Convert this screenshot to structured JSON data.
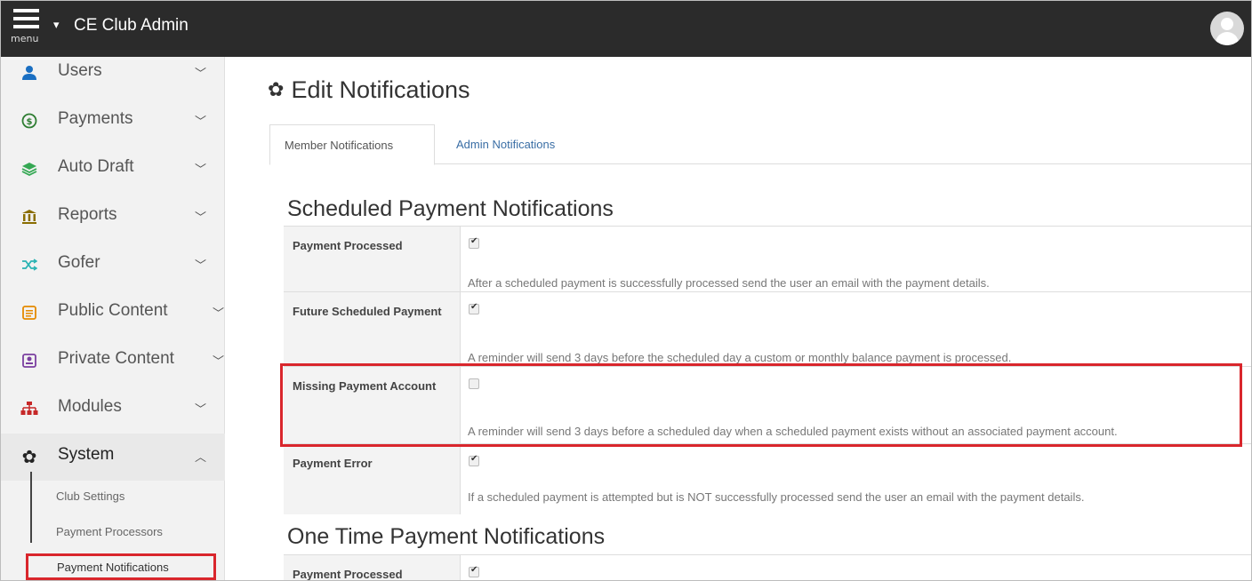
{
  "header": {
    "menu_label": "menu",
    "app_title": "CE Club Admin"
  },
  "sidebar": {
    "items": [
      {
        "label": "Users",
        "icon": "user-icon",
        "color": "#1a6fc2"
      },
      {
        "label": "Payments",
        "icon": "dollar-circle-icon",
        "color": "#2e7d32"
      },
      {
        "label": "Auto Draft",
        "icon": "layers-icon",
        "color": "#34a853"
      },
      {
        "label": "Reports",
        "icon": "bank-icon",
        "color": "#8a6d00"
      },
      {
        "label": "Gofer",
        "icon": "shuffle-icon",
        "color": "#2bb3b3"
      },
      {
        "label": "Public Content",
        "icon": "document-icon",
        "color": "#e58a00"
      },
      {
        "label": "Private Content",
        "icon": "private-document-icon",
        "color": "#7b3fa0"
      },
      {
        "label": "Modules",
        "icon": "sitemap-icon",
        "color": "#c62828"
      },
      {
        "label": "System",
        "icon": "gear-icon",
        "color": "#222222"
      }
    ],
    "system_subitems": [
      "Club Settings",
      "Payment Processors",
      "Payment Notifications"
    ]
  },
  "main": {
    "title": "Edit Notifications",
    "tabs": [
      "Member Notifications",
      "Admin Notifications"
    ],
    "scheduled": {
      "title": "Scheduled Payment Notifications",
      "rows": [
        {
          "label": "Payment Processed",
          "checked": true,
          "description": "After a scheduled payment is successfully processed send the user an email with the payment details."
        },
        {
          "label": "Future Scheduled Payment",
          "checked": true,
          "description": "A reminder will send 3 days before the scheduled day a custom or monthly balance payment is processed."
        },
        {
          "label": "Missing Payment Account",
          "checked": false,
          "description": "A reminder will send 3 days before a scheduled day when a scheduled payment exists without an associated payment account."
        },
        {
          "label": "Payment Error",
          "checked": true,
          "description": "If a scheduled payment is attempted but is NOT successfully processed send the user an email with the payment details."
        }
      ]
    },
    "one_time": {
      "title": "One Time Payment Notifications",
      "rows": [
        {
          "label": "Payment Processed",
          "checked": true
        }
      ]
    }
  },
  "colors": {
    "topbar": "#2b2b2b",
    "highlight": "#d9262c",
    "link": "#3a6ea5"
  }
}
